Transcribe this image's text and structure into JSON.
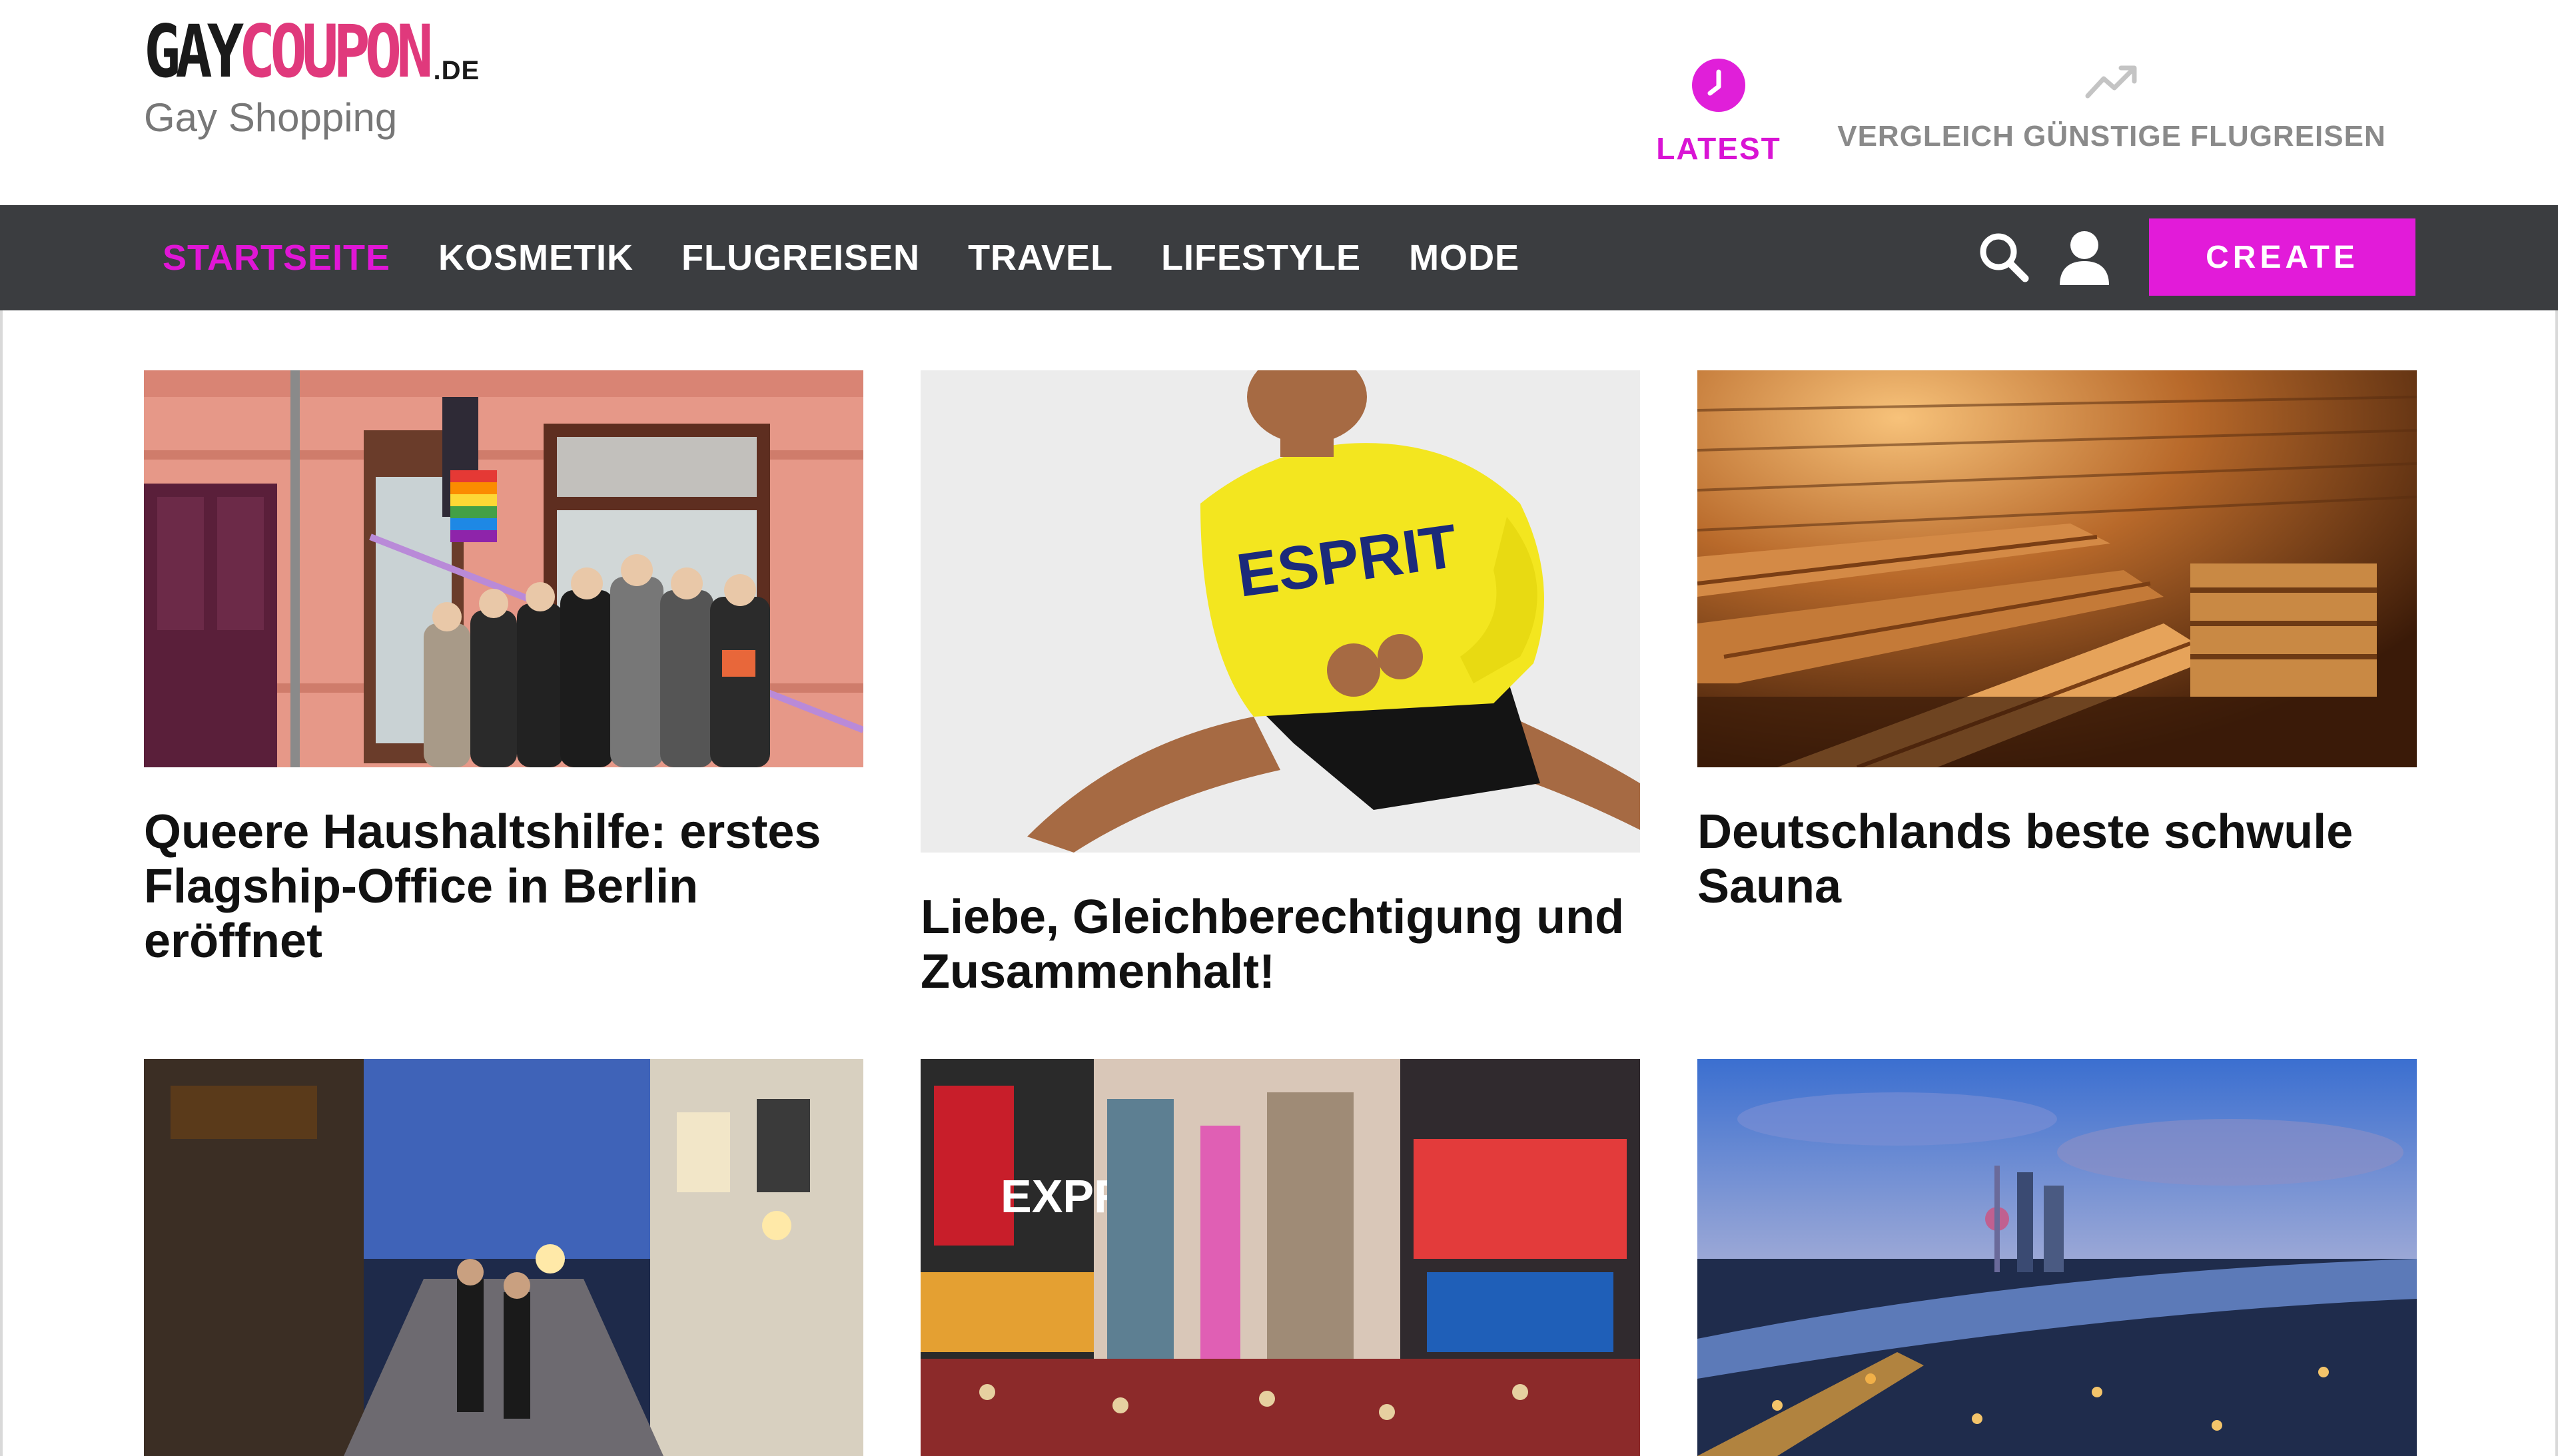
{
  "header": {
    "logo": {
      "gay": "GAY",
      "coupon": "COUPON",
      "tld": ".DE"
    },
    "tagline": "Gay Shopping",
    "links": [
      {
        "label": "LATEST",
        "icon": "clock-icon",
        "color": "#d914d4"
      },
      {
        "label": "VERGLEICH GÜNSTIGE FLUGREISEN",
        "icon": "trending-up-icon",
        "color": "#8a8a8a"
      }
    ]
  },
  "nav": {
    "items": [
      {
        "label": "STARTSEITE",
        "active": true
      },
      {
        "label": "KOSMETIK",
        "active": false
      },
      {
        "label": "FLUGREISEN",
        "active": false
      },
      {
        "label": "TRAVEL",
        "active": false
      },
      {
        "label": "LIFESTYLE",
        "active": false
      },
      {
        "label": "MODE",
        "active": false
      }
    ],
    "search_icon": "search-icon",
    "user_icon": "user-icon",
    "create_label": "CREATE"
  },
  "colors": {
    "accent": "#e21bd9",
    "navbar_bg": "#3b3d40",
    "logo_pink": "#e0397c"
  },
  "posts": [
    {
      "title": "Queere Haushaltshilfe: erstes Flagship-Office in Berlin eröffnet",
      "image": "people-opening-office-photo"
    },
    {
      "title": "Liebe, Gleichberechtigung und Zusammenhalt!",
      "image": "man-yellow-esprit-sweater-photo",
      "image_text": "ESPRIT"
    },
    {
      "title": "Deutschlands beste schwule Sauna",
      "image": "wooden-sauna-photo"
    },
    {
      "title": "",
      "image": "night-street-photo"
    },
    {
      "title": "",
      "image": "times-square-photo",
      "image_text": "EXPR"
    },
    {
      "title": "",
      "image": "city-skyline-night-photo"
    }
  ]
}
